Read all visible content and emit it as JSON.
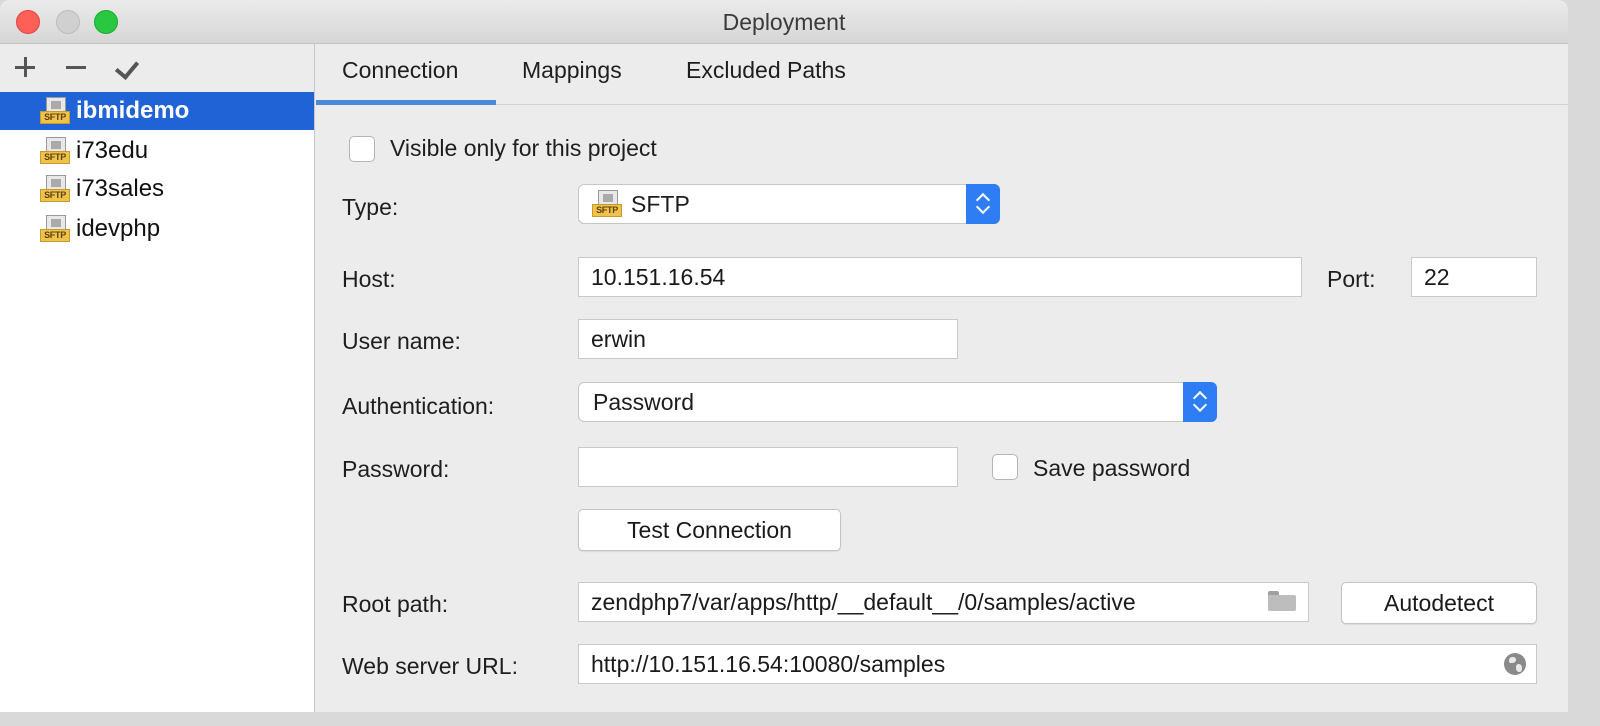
{
  "window": {
    "title": "Deployment"
  },
  "sidebar": {
    "toolbar": {
      "add_icon": "plus-icon",
      "remove_icon": "minus-icon",
      "apply_icon": "checkmark-icon"
    },
    "servers": [
      {
        "name": "ibmidemo",
        "type_badge": "SFTP",
        "selected": true
      },
      {
        "name": "i73edu",
        "type_badge": "SFTP",
        "selected": false
      },
      {
        "name": "i73sales",
        "type_badge": "SFTP",
        "selected": false
      },
      {
        "name": "idevphp",
        "type_badge": "SFTP",
        "selected": false
      }
    ]
  },
  "tabs": [
    {
      "label": "Connection",
      "active": true
    },
    {
      "label": "Mappings",
      "active": false
    },
    {
      "label": "Excluded Paths",
      "active": false
    }
  ],
  "form": {
    "visible_only": {
      "label": "Visible only for this project",
      "checked": false
    },
    "type": {
      "label": "Type:",
      "value": "SFTP",
      "badge": "SFTP"
    },
    "host": {
      "label": "Host:",
      "value": "10.151.16.54"
    },
    "port": {
      "label": "Port:",
      "value": "22"
    },
    "user": {
      "label": "User name:",
      "value": "erwin"
    },
    "auth": {
      "label": "Authentication:",
      "value": "Password"
    },
    "password": {
      "label": "Password:",
      "value": ""
    },
    "save_password": {
      "label": "Save password",
      "checked": false
    },
    "test_connection": {
      "label": "Test Connection"
    },
    "root_path": {
      "label": "Root path:",
      "value": "zendphp7/var/apps/http/__default__/0/samples/active"
    },
    "autodetect": {
      "label": "Autodetect"
    },
    "web_url": {
      "label": "Web server URL:",
      "value": "http://10.151.16.54:10080/samples"
    }
  },
  "colors": {
    "selection": "#1f63d6",
    "accent": "#2f7df5",
    "tab_underline": "#4c88d8"
  }
}
